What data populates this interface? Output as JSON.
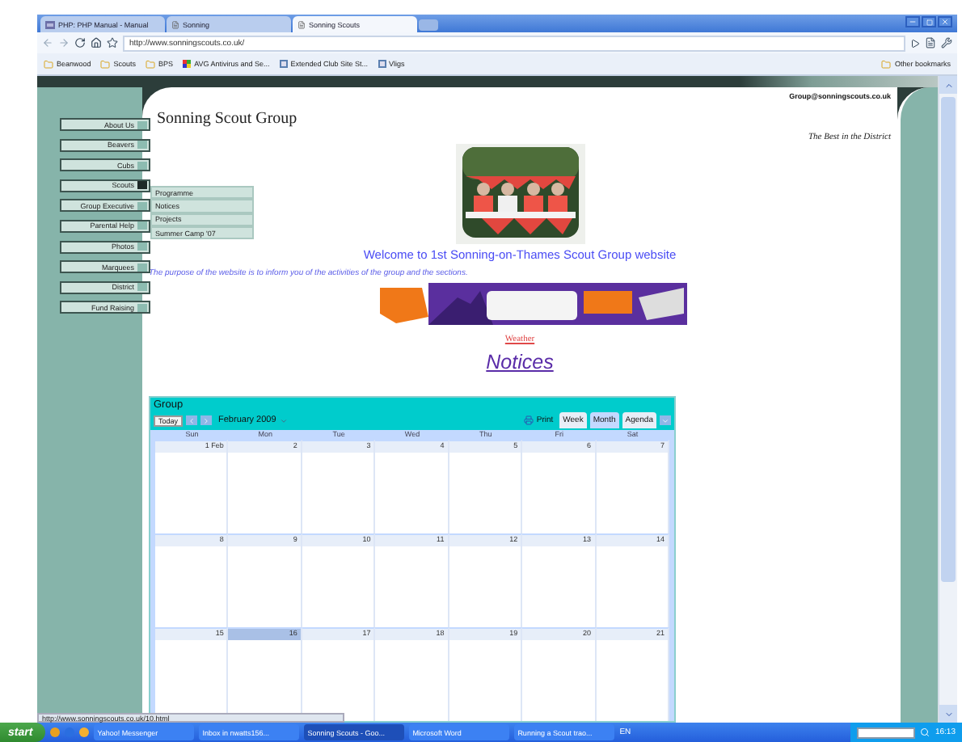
{
  "browser": {
    "tabs": [
      {
        "label": "PHP: PHP Manual - Manual",
        "selected": false,
        "kind": "php"
      },
      {
        "label": "Sonning",
        "selected": false,
        "kind": "page"
      },
      {
        "label": "Sonning Scouts",
        "selected": true,
        "kind": "page"
      }
    ],
    "url": "http://www.sonningscouts.co.uk/",
    "bookmarks": [
      {
        "label": "Beanwood",
        "kind": "folder"
      },
      {
        "label": "Scouts",
        "kind": "folder"
      },
      {
        "label": "BPS",
        "kind": "folder"
      },
      {
        "label": "AVG Antivirus and Se...",
        "kind": "avg"
      },
      {
        "label": "Extended Club Site St...",
        "kind": "site"
      },
      {
        "label": "Vligs",
        "kind": "site"
      }
    ],
    "other_bookmarks": "Other bookmarks",
    "status": "http://www.sonningscouts.co.uk/10.html"
  },
  "site": {
    "email": "Group@sonningscouts.co.uk",
    "title": "Sonning Scout Group",
    "tagline": "The Best in the District",
    "nav": [
      {
        "label": "About Us",
        "selected": false
      },
      {
        "label": "Beavers",
        "selected": false
      },
      {
        "label": "Cubs",
        "selected": false
      },
      {
        "label": "Scouts",
        "selected": true
      },
      {
        "label": "Group Executive",
        "selected": false
      },
      {
        "label": "Parental Help",
        "selected": false
      },
      {
        "label": "Photos",
        "selected": false
      },
      {
        "label": "Marquees",
        "selected": false
      },
      {
        "label": "District",
        "selected": false
      },
      {
        "label": "Fund Raising",
        "selected": false
      }
    ],
    "submenu": [
      "Programme",
      "Notices",
      "Projects",
      "Summer Camp '07"
    ],
    "welcome": "Welcome to 1st Sonning-on-Thames Scout Group website",
    "purpose": "The purpose of the website is to inform you of the activities of the group and the sections.",
    "weather_link": "Weather",
    "notices_heading": "Notices"
  },
  "calendar": {
    "title": "Group",
    "today_button": "Today",
    "month": "February 2009",
    "print": "Print",
    "views": [
      {
        "label": "Week",
        "selected": false
      },
      {
        "label": "Month",
        "selected": true
      },
      {
        "label": "Agenda",
        "selected": false
      }
    ],
    "weekdays": [
      "Sun",
      "Mon",
      "Tue",
      "Wed",
      "Thu",
      "Fri",
      "Sat"
    ],
    "weeks": [
      [
        {
          "label": "1 Feb",
          "today": false
        },
        {
          "label": "2",
          "today": false
        },
        {
          "label": "3",
          "today": false
        },
        {
          "label": "4",
          "today": false
        },
        {
          "label": "5",
          "today": false
        },
        {
          "label": "6",
          "today": false
        },
        {
          "label": "7",
          "today": false
        }
      ],
      [
        {
          "label": "8",
          "today": false
        },
        {
          "label": "9",
          "today": false
        },
        {
          "label": "10",
          "today": false
        },
        {
          "label": "11",
          "today": false
        },
        {
          "label": "12",
          "today": false
        },
        {
          "label": "13",
          "today": false
        },
        {
          "label": "14",
          "today": false
        }
      ],
      [
        {
          "label": "15",
          "today": false
        },
        {
          "label": "16",
          "today": true
        },
        {
          "label": "17",
          "today": false
        },
        {
          "label": "18",
          "today": false
        },
        {
          "label": "19",
          "today": false
        },
        {
          "label": "20",
          "today": false
        },
        {
          "label": "21",
          "today": false
        }
      ]
    ]
  },
  "taskbar": {
    "start": "start",
    "items": [
      {
        "label": "Yahoo! Messenger",
        "selected": false
      },
      {
        "label": "Inbox in nwatts156...",
        "selected": false
      },
      {
        "label": "Sonning Scouts - Goo...",
        "selected": true
      },
      {
        "label": "Microsoft Word",
        "selected": false
      },
      {
        "label": "Running a Scout trao...",
        "selected": false
      }
    ],
    "language": "EN",
    "clock": "16:13"
  }
}
